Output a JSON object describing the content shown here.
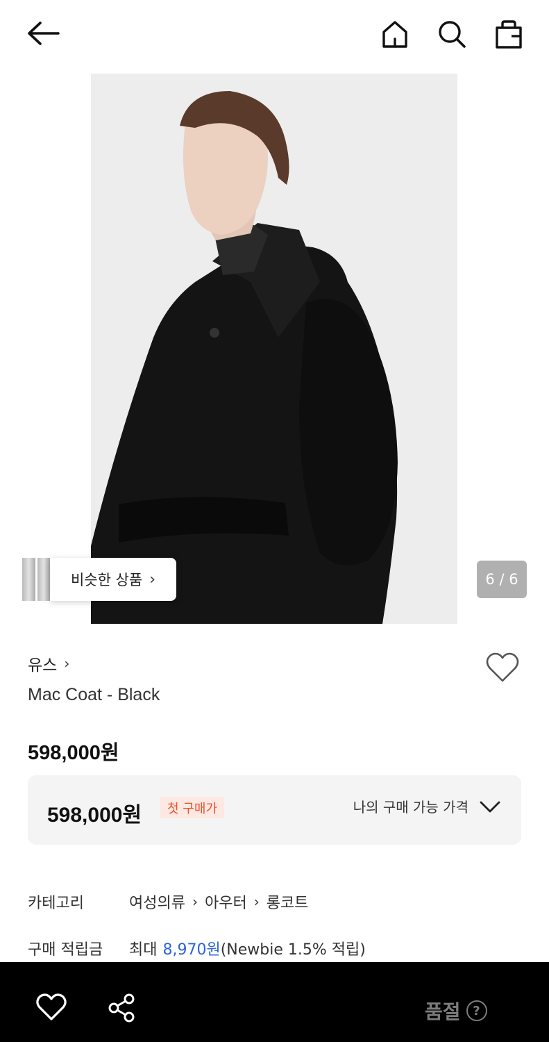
{
  "header": {
    "back_icon": "arrow-left-icon",
    "home_icon": "home-icon",
    "search_icon": "search-icon",
    "bag_icon": "shopping-bag-icon"
  },
  "gallery": {
    "similar_label": "비슷한 상품",
    "similar_chevron": "›",
    "counter": "6 / 6"
  },
  "product": {
    "brand": "유스",
    "brand_chevron": "›",
    "title": "Mac Coat - Black",
    "price": "598,000원"
  },
  "price_box": {
    "price": "598,000원",
    "badge": "첫 구매가",
    "toggle_label": "나의 구매 가능 가격"
  },
  "details": {
    "category_label": "카테고리",
    "categories": [
      "여성의류",
      "아우터",
      "롱코트"
    ],
    "category_sep": "›",
    "points_label": "구매 적립금",
    "points_prefix": "최대",
    "points_value": "8,970원",
    "points_suffix": "(Newbie 1.5% 적립)"
  },
  "bottom_bar": {
    "wish_icon": "heart-icon",
    "share_icon": "share-icon",
    "status": "품절",
    "help_icon": "question-circle-icon",
    "help_glyph": "?"
  },
  "colors": {
    "accent_blue": "#2d64d6",
    "badge_text": "#e8502c",
    "badge_bg": "#fde8e2",
    "bottom_bar_bg": "#000000"
  }
}
